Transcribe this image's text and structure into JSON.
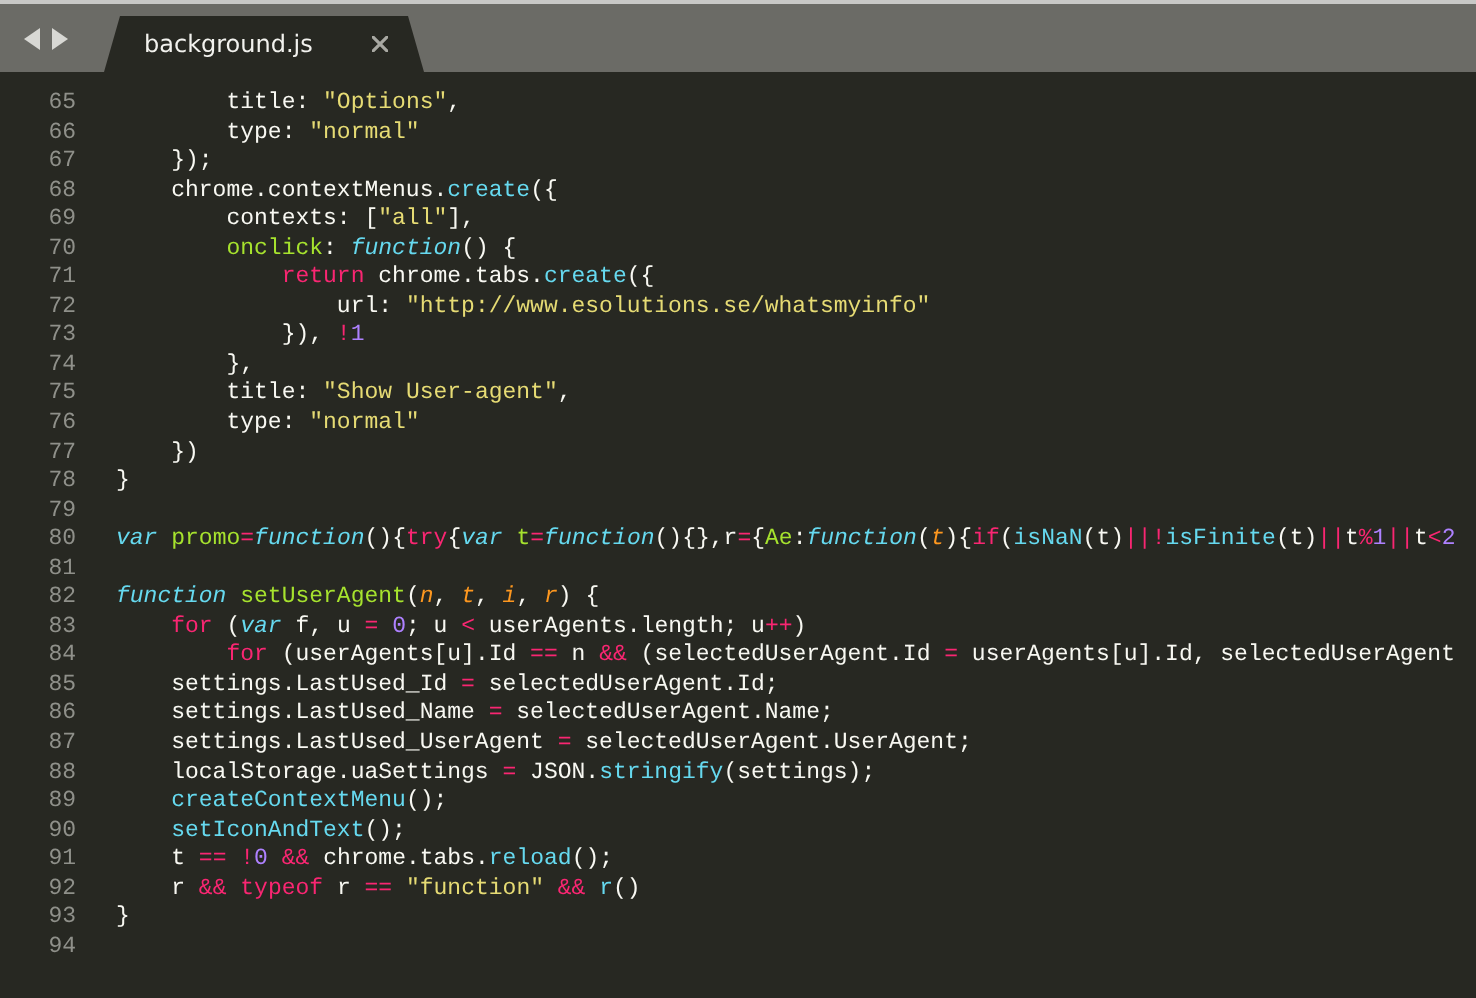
{
  "tabs": [
    {
      "label": "background.js",
      "selected": true
    }
  ],
  "editor": {
    "lines": [
      {
        "number": "65",
        "tokens": [
          {
            "kind": "plain",
            "text": "        title: "
          },
          {
            "kind": "string",
            "text": "\"Options\""
          },
          {
            "kind": "plain",
            "text": ","
          }
        ]
      },
      {
        "number": "66",
        "tokens": [
          {
            "kind": "plain",
            "text": "        type: "
          },
          {
            "kind": "string",
            "text": "\"normal\""
          }
        ]
      },
      {
        "number": "67",
        "tokens": [
          {
            "kind": "plain",
            "text": "    });"
          }
        ]
      },
      {
        "number": "68",
        "tokens": [
          {
            "kind": "plain",
            "text": "    chrome.contextMenus."
          },
          {
            "kind": "support",
            "text": "create"
          },
          {
            "kind": "plain",
            "text": "({"
          }
        ]
      },
      {
        "number": "69",
        "tokens": [
          {
            "kind": "plain",
            "text": "        contexts: ["
          },
          {
            "kind": "string",
            "text": "\"all\""
          },
          {
            "kind": "plain",
            "text": "],"
          }
        ]
      },
      {
        "number": "70",
        "tokens": [
          {
            "kind": "entity",
            "text": "        onclick"
          },
          {
            "kind": "plain",
            "text": ": "
          },
          {
            "kind": "storage",
            "text": "function"
          },
          {
            "kind": "plain",
            "text": "() {"
          }
        ]
      },
      {
        "number": "71",
        "tokens": [
          {
            "kind": "keyword",
            "text": "            return"
          },
          {
            "kind": "plain",
            "text": " chrome.tabs."
          },
          {
            "kind": "support",
            "text": "create"
          },
          {
            "kind": "plain",
            "text": "({"
          }
        ]
      },
      {
        "number": "72",
        "tokens": [
          {
            "kind": "plain",
            "text": "                url: "
          },
          {
            "kind": "string",
            "text": "\"http://www.esolutions.se/whatsmyinfo\""
          }
        ]
      },
      {
        "number": "73",
        "tokens": [
          {
            "kind": "plain",
            "text": "            }), "
          },
          {
            "kind": "keyword",
            "text": "!"
          },
          {
            "kind": "number",
            "text": "1"
          }
        ]
      },
      {
        "number": "74",
        "tokens": [
          {
            "kind": "plain",
            "text": "        },"
          }
        ]
      },
      {
        "number": "75",
        "tokens": [
          {
            "kind": "plain",
            "text": "        title: "
          },
          {
            "kind": "string",
            "text": "\"Show User-agent\""
          },
          {
            "kind": "plain",
            "text": ","
          }
        ]
      },
      {
        "number": "76",
        "tokens": [
          {
            "kind": "plain",
            "text": "        type: "
          },
          {
            "kind": "string",
            "text": "\"normal\""
          }
        ]
      },
      {
        "number": "77",
        "tokens": [
          {
            "kind": "plain",
            "text": "    })"
          }
        ]
      },
      {
        "number": "78",
        "tokens": [
          {
            "kind": "plain",
            "text": "}"
          }
        ]
      },
      {
        "number": "79"
      },
      {
        "number": "80",
        "tokens": [
          {
            "kind": "storage",
            "text": "var"
          },
          {
            "kind": "entity",
            "text": " promo"
          },
          {
            "kind": "keyword",
            "text": "="
          },
          {
            "kind": "storage",
            "text": "function"
          },
          {
            "kind": "plain",
            "text": "(){"
          },
          {
            "kind": "keyword",
            "text": "try"
          },
          {
            "kind": "plain",
            "text": "{"
          },
          {
            "kind": "storage",
            "text": "var"
          },
          {
            "kind": "entity",
            "text": " t"
          },
          {
            "kind": "keyword",
            "text": "="
          },
          {
            "kind": "storage",
            "text": "function"
          },
          {
            "kind": "plain",
            "text": "(){},r"
          },
          {
            "kind": "keyword",
            "text": "="
          },
          {
            "kind": "plain",
            "text": "{"
          },
          {
            "kind": "entity",
            "text": "Ae"
          },
          {
            "kind": "plain",
            "text": ":"
          },
          {
            "kind": "storage",
            "text": "function"
          },
          {
            "kind": "plain",
            "text": "("
          },
          {
            "kind": "param",
            "text": "t"
          },
          {
            "kind": "plain",
            "text": "){"
          },
          {
            "kind": "keyword",
            "text": "if"
          },
          {
            "kind": "plain",
            "text": "("
          },
          {
            "kind": "support",
            "text": "isNaN"
          },
          {
            "kind": "plain",
            "text": "(t)"
          },
          {
            "kind": "keyword",
            "text": "||!"
          },
          {
            "kind": "support",
            "text": "isFinite"
          },
          {
            "kind": "plain",
            "text": "(t)"
          },
          {
            "kind": "keyword",
            "text": "||"
          },
          {
            "kind": "plain",
            "text": "t"
          },
          {
            "kind": "keyword",
            "text": "%"
          },
          {
            "kind": "number",
            "text": "1"
          },
          {
            "kind": "keyword",
            "text": "||"
          },
          {
            "kind": "plain",
            "text": "t"
          },
          {
            "kind": "keyword",
            "text": "<"
          },
          {
            "kind": "number",
            "text": "2"
          }
        ]
      },
      {
        "number": "81"
      },
      {
        "number": "82",
        "tokens": [
          {
            "kind": "storage",
            "text": "function"
          },
          {
            "kind": "entity",
            "text": " setUserAgent"
          },
          {
            "kind": "plain",
            "text": "("
          },
          {
            "kind": "param",
            "text": "n"
          },
          {
            "kind": "plain",
            "text": ", "
          },
          {
            "kind": "param",
            "text": "t"
          },
          {
            "kind": "plain",
            "text": ", "
          },
          {
            "kind": "param",
            "text": "i"
          },
          {
            "kind": "plain",
            "text": ", "
          },
          {
            "kind": "param",
            "text": "r"
          },
          {
            "kind": "plain",
            "text": ") {"
          }
        ]
      },
      {
        "number": "83",
        "tokens": [
          {
            "kind": "keyword",
            "text": "    for"
          },
          {
            "kind": "plain",
            "text": " ("
          },
          {
            "kind": "storage",
            "text": "var"
          },
          {
            "kind": "plain",
            "text": " f, u "
          },
          {
            "kind": "keyword",
            "text": "="
          },
          {
            "kind": "number",
            "text": " 0"
          },
          {
            "kind": "plain",
            "text": "; u "
          },
          {
            "kind": "keyword",
            "text": "<"
          },
          {
            "kind": "plain",
            "text": " userAgents.length; u"
          },
          {
            "kind": "keyword",
            "text": "++"
          },
          {
            "kind": "plain",
            "text": ")"
          }
        ]
      },
      {
        "number": "84",
        "tokens": [
          {
            "kind": "keyword",
            "text": "        for"
          },
          {
            "kind": "plain",
            "text": " (userAgents[u].Id "
          },
          {
            "kind": "keyword",
            "text": "=="
          },
          {
            "kind": "plain",
            "text": " n "
          },
          {
            "kind": "keyword",
            "text": "&&"
          },
          {
            "kind": "plain",
            "text": " (selectedUserAgent.Id "
          },
          {
            "kind": "keyword",
            "text": "="
          },
          {
            "kind": "plain",
            "text": " userAgents[u].Id, selectedUserAgent"
          }
        ]
      },
      {
        "number": "85",
        "tokens": [
          {
            "kind": "plain",
            "text": "    settings.LastUsed_Id "
          },
          {
            "kind": "keyword",
            "text": "="
          },
          {
            "kind": "plain",
            "text": " selectedUserAgent.Id;"
          }
        ]
      },
      {
        "number": "86",
        "tokens": [
          {
            "kind": "plain",
            "text": "    settings.LastUsed_Name "
          },
          {
            "kind": "keyword",
            "text": "="
          },
          {
            "kind": "plain",
            "text": " selectedUserAgent.Name;"
          }
        ]
      },
      {
        "number": "87",
        "tokens": [
          {
            "kind": "plain",
            "text": "    settings.LastUsed_UserAgent "
          },
          {
            "kind": "keyword",
            "text": "="
          },
          {
            "kind": "plain",
            "text": " selectedUserAgent.UserAgent;"
          }
        ]
      },
      {
        "number": "88",
        "tokens": [
          {
            "kind": "plain",
            "text": "    localStorage.uaSettings "
          },
          {
            "kind": "keyword",
            "text": "="
          },
          {
            "kind": "plain",
            "text": " JSON."
          },
          {
            "kind": "support",
            "text": "stringify"
          },
          {
            "kind": "plain",
            "text": "(settings);"
          }
        ]
      },
      {
        "number": "89",
        "tokens": [
          {
            "kind": "support",
            "text": "    createContextMenu"
          },
          {
            "kind": "plain",
            "text": "();"
          }
        ]
      },
      {
        "number": "90",
        "tokens": [
          {
            "kind": "support",
            "text": "    setIconAndText"
          },
          {
            "kind": "plain",
            "text": "();"
          }
        ]
      },
      {
        "number": "91",
        "tokens": [
          {
            "kind": "plain",
            "text": "    t "
          },
          {
            "kind": "keyword",
            "text": "=="
          },
          {
            "kind": "keyword",
            "text": " !"
          },
          {
            "kind": "number",
            "text": "0"
          },
          {
            "kind": "keyword",
            "text": " &&"
          },
          {
            "kind": "plain",
            "text": " chrome.tabs."
          },
          {
            "kind": "support",
            "text": "reload"
          },
          {
            "kind": "plain",
            "text": "();"
          }
        ]
      },
      {
        "number": "92",
        "tokens": [
          {
            "kind": "plain",
            "text": "    r "
          },
          {
            "kind": "keyword",
            "text": "&&"
          },
          {
            "kind": "keyword",
            "text": " typeof"
          },
          {
            "kind": "plain",
            "text": " r "
          },
          {
            "kind": "keyword",
            "text": "=="
          },
          {
            "kind": "string",
            "text": " \"function\""
          },
          {
            "kind": "keyword",
            "text": " &&"
          },
          {
            "kind": "support",
            "text": " r"
          },
          {
            "kind": "plain",
            "text": "()"
          }
        ]
      },
      {
        "number": "93",
        "tokens": [
          {
            "kind": "plain",
            "text": "}"
          }
        ]
      },
      {
        "number": "94"
      }
    ]
  }
}
